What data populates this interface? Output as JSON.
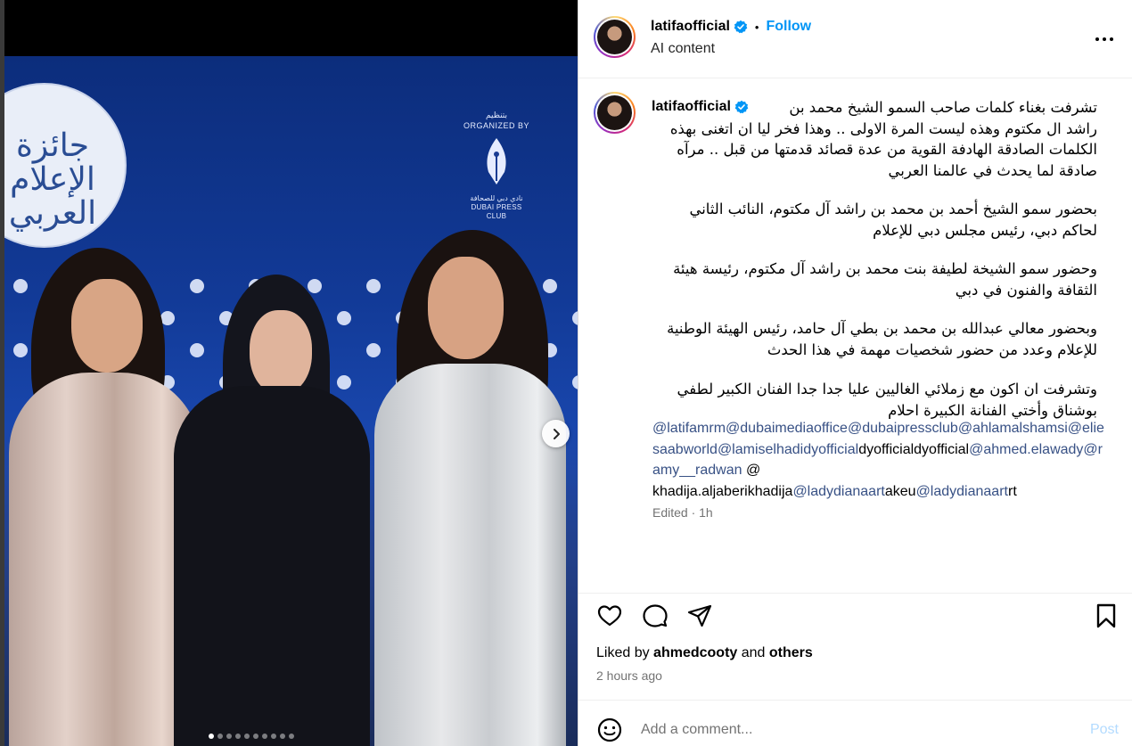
{
  "post": {
    "username": "latifaofficial",
    "follow_label": "Follow",
    "bullet": "•",
    "subtitle": "AI content",
    "edited": "Edited · 1h",
    "liked_prefix": "Liked by",
    "liked_user": "ahmedcooty",
    "liked_and": "and",
    "liked_others": "others",
    "time_ago": "2 hours ago",
    "comment_placeholder": "Add a comment...",
    "post_label": "Post"
  },
  "caption": {
    "para1": [
      "تشرفت بغناء كلمات صاحب السمو الشيخ محمد بن",
      "راشد ال مكتوم وهذه ليست المرة الاولى .. وهذا فخر ليا ان اتغنى بهذه",
      "الكلمات الصادقة الهادفة القوية من عدة قصائد قدمتها من قبل .. مرآه",
      "صادقة لما يحدث في عالمنا العربي"
    ],
    "para2": [
      "بحضور سمو الشيخ أحمد بن محمد بن راشد آل مكتوم، النائب الثاني",
      "لحاكم دبي، رئيس مجلس دبي للإعلام"
    ],
    "para3": [
      "وحضور سمو الشيخة لطيفة بنت محمد بن راشد آل مكتوم، رئيسة هيئة",
      "الثقافة والفنون في دبي"
    ],
    "para4": [
      "وبحضور معالي عبدالله بن محمد بن بطي آل حامد، رئيس الهيئة الوطنية",
      "للإعلام وعدد من حضور شخصيات مهمة في هذا الحدث"
    ],
    "para5": [
      "وتشرفت ان اكون مع زملائي الغاليين عليا جدا جدا الفنان الكبير لطفي",
      "بوشناق وأختي الفنانة الكبيرة احلام"
    ],
    "mentions": {
      "m1": "@latifamrm",
      "m2": "@dubaimediaoffice",
      "m3": "@dubaipressclub",
      "m4": "@ahlamalshamsi",
      "m5": "@eliesaabworld",
      "m6": "@lamiselhadidyofficial",
      "plain1": "dyofficialdyofficial",
      "m7": "@ahmed.elawady",
      "m8": "@ramy__radwan",
      "plain2": " @",
      "plain3": "khadija.aljaberikhadija",
      "m9": "@ladydianaart",
      "plain4": "akeu",
      "m10": "@ladydianaart",
      "plain5": "rt"
    }
  },
  "media": {
    "award_calligraphy": "جائزة الإعلام العربي",
    "organized_ar": "بتنظيم",
    "organized_en": "ORGANIZED BY",
    "club_ar": "نادي دبي للصحافة",
    "club_en": "DUBAI PRESS CLUB",
    "carousel_count": 10,
    "carousel_active": 0
  },
  "icons": {
    "verified": "verified-badge-icon",
    "more": "more-options-icon",
    "like": "heart-icon",
    "comment": "comment-icon",
    "share": "share-icon",
    "save": "bookmark-icon",
    "emoji": "emoji-icon",
    "next": "chevron-right-icon"
  },
  "colors": {
    "accent": "#0095f6",
    "mention": "#385185",
    "muted": "#737373",
    "post_disabled": "#b3dbff"
  }
}
